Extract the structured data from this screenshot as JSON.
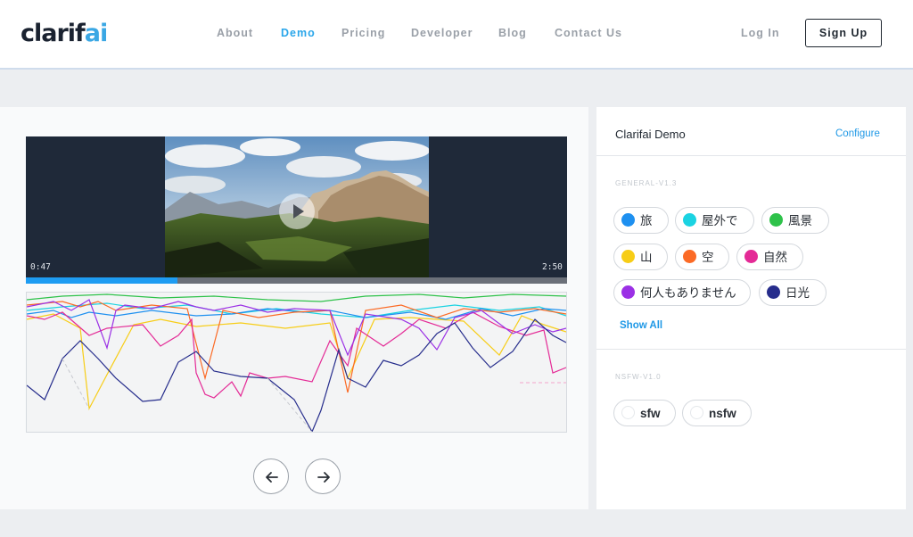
{
  "header": {
    "logo_main": "clarif",
    "logo_accent": "ai",
    "nav": [
      {
        "label": "About",
        "active": false
      },
      {
        "label": "Demo",
        "active": true
      },
      {
        "label": "Pricing",
        "active": false
      },
      {
        "label": "Developer",
        "active": false
      },
      {
        "label": "Blog",
        "active": false
      },
      {
        "label": "Contact Us",
        "active": false
      }
    ],
    "login_label": "Log In",
    "signup_label": "Sign Up"
  },
  "video": {
    "current_time": "0:47",
    "duration": "2:50",
    "progress": 0.28
  },
  "side_panel": {
    "title": "Clarifai Demo",
    "configure_label": "Configure",
    "general_model": {
      "label": "GENERAL-V1.3",
      "tags": [
        {
          "label": "旅",
          "color": "#1e90f0"
        },
        {
          "label": "屋外で",
          "color": "#1bd3e2"
        },
        {
          "label": "風景",
          "color": "#2ec24a"
        },
        {
          "label": "山",
          "color": "#f7cd16"
        },
        {
          "label": "空",
          "color": "#fb6a25"
        },
        {
          "label": "自然",
          "color": "#e42a96"
        },
        {
          "label": "何人もありません",
          "color": "#9b30e5"
        },
        {
          "label": "日光",
          "color": "#262d8c"
        }
      ],
      "show_all_label": "Show All"
    },
    "nsfw_model": {
      "label": "NSFW-V1.0",
      "tags": [
        {
          "label": "sfw"
        },
        {
          "label": "nsfw"
        }
      ]
    }
  }
}
